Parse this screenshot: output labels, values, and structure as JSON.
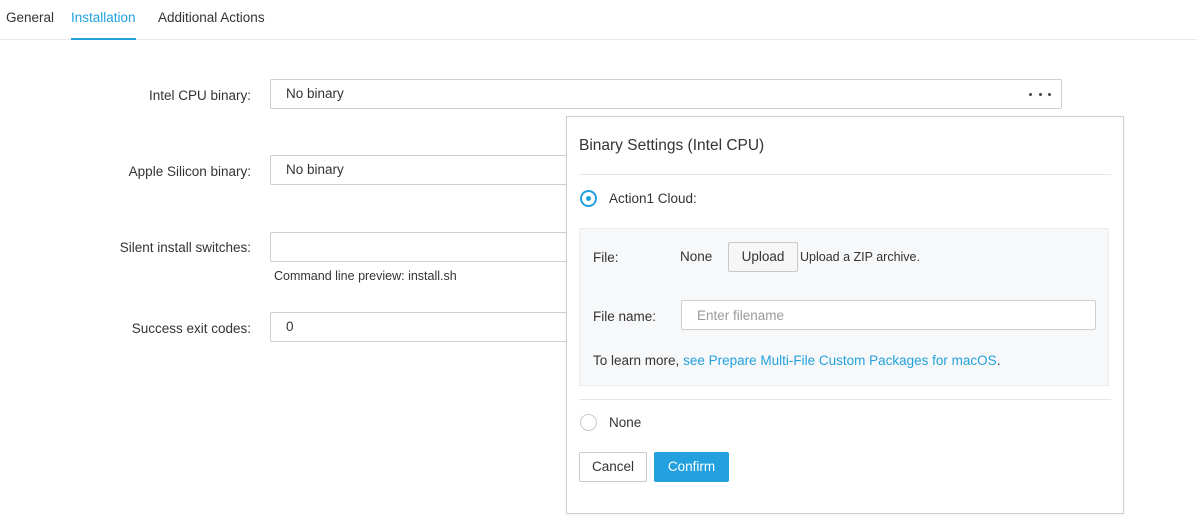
{
  "tabs": [
    {
      "label": "General",
      "active": false
    },
    {
      "label": "Installation",
      "active": true
    },
    {
      "label": "Additional Actions",
      "active": false
    }
  ],
  "form": {
    "intel_label": "Intel CPU binary:",
    "intel_value": "No binary",
    "apple_label": "Apple Silicon binary:",
    "apple_value": "No binary",
    "silent_label": "Silent install switches:",
    "silent_value": "",
    "preview": "Command line preview: install.sh",
    "exit_label": "Success exit codes:",
    "exit_value": "0"
  },
  "popup": {
    "title": "Binary Settings (Intel CPU)",
    "option_cloud": "Action1 Cloud:",
    "file_label": "File:",
    "file_value": "None",
    "upload_label": "Upload",
    "upload_hint": "Upload a ZIP archive.",
    "filename_label": "File name:",
    "filename_placeholder": "Enter filename",
    "learn_prefix": "To learn more,",
    "learn_link": "see Prepare Multi-File Custom Packages for macOS",
    "learn_suffix": ".",
    "option_none": "None",
    "cancel_label": "Cancel",
    "confirm_label": "Confirm",
    "selected_option": "Action1 Cloud"
  },
  "colors": {
    "accent": "#22a1de",
    "border": "#cfcfcf",
    "inner_background": "#f7f8fa"
  },
  "icons": {
    "more": "ellipsis-horizontal-icon",
    "radio_on": "radio-checked-icon",
    "radio_off": "radio-unchecked-icon"
  }
}
